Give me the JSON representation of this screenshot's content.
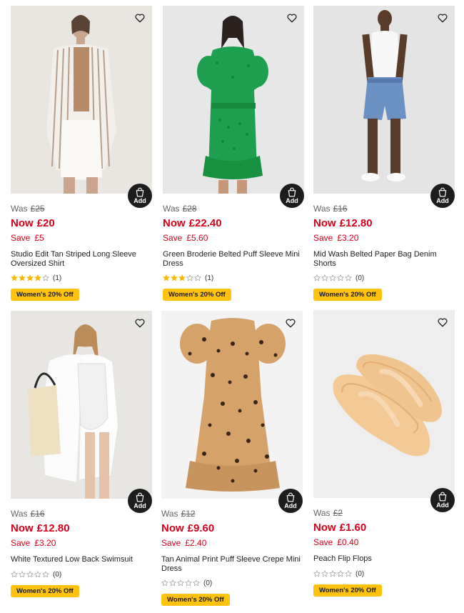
{
  "labels": {
    "was": "Was",
    "now": "Now",
    "save": "Save",
    "add": "Add"
  },
  "products": [
    {
      "title": "Studio Edit Tan Striped Long Sleeve Oversized Shirt",
      "was_price": "£25",
      "now_price": "£20",
      "save_amount": "£5",
      "rating_count": "(1)",
      "rating": 4,
      "badge": "Women's 20% Off"
    },
    {
      "title": "Green Broderie Belted Puff Sleeve Mini Dress",
      "was_price": "£28",
      "now_price": "£22.40",
      "save_amount": "£5.60",
      "rating_count": "(1)",
      "rating": 3,
      "badge": "Women's 20% Off"
    },
    {
      "title": "Mid Wash Belted Paper Bag Denim Shorts",
      "was_price": "£16",
      "now_price": "£12.80",
      "save_amount": "£3.20",
      "rating_count": "(0)",
      "rating": 0,
      "badge": "Women's 20% Off"
    },
    {
      "title": "White Textured Low Back Swimsuit",
      "was_price": "£16",
      "now_price": "£12.80",
      "save_amount": "£3.20",
      "rating_count": "(0)",
      "rating": 0,
      "badge": "Women's 20% Off"
    },
    {
      "title": "Tan Animal Print Puff Sleeve Crepe Mini Dress",
      "was_price": "£12",
      "now_price": "£9.60",
      "save_amount": "£2.40",
      "rating_count": "(0)",
      "rating": 0,
      "badge": "Women's 20% Off"
    },
    {
      "title": "Peach Flip Flops",
      "was_price": "£2",
      "now_price": "£1.60",
      "save_amount": "£0.40",
      "rating_count": "(0)",
      "rating": 0,
      "badge": "Women's 20% Off"
    }
  ],
  "icons": {
    "favourite": "heart-outline-icon",
    "add_to_basket": "shopping-bag-icon",
    "star": "star-icon"
  },
  "colors": {
    "price_red": "#d7001a",
    "badge_yellow": "#ffc20e",
    "star_gold": "#f6b800",
    "add_button": "#1d1d1d"
  }
}
